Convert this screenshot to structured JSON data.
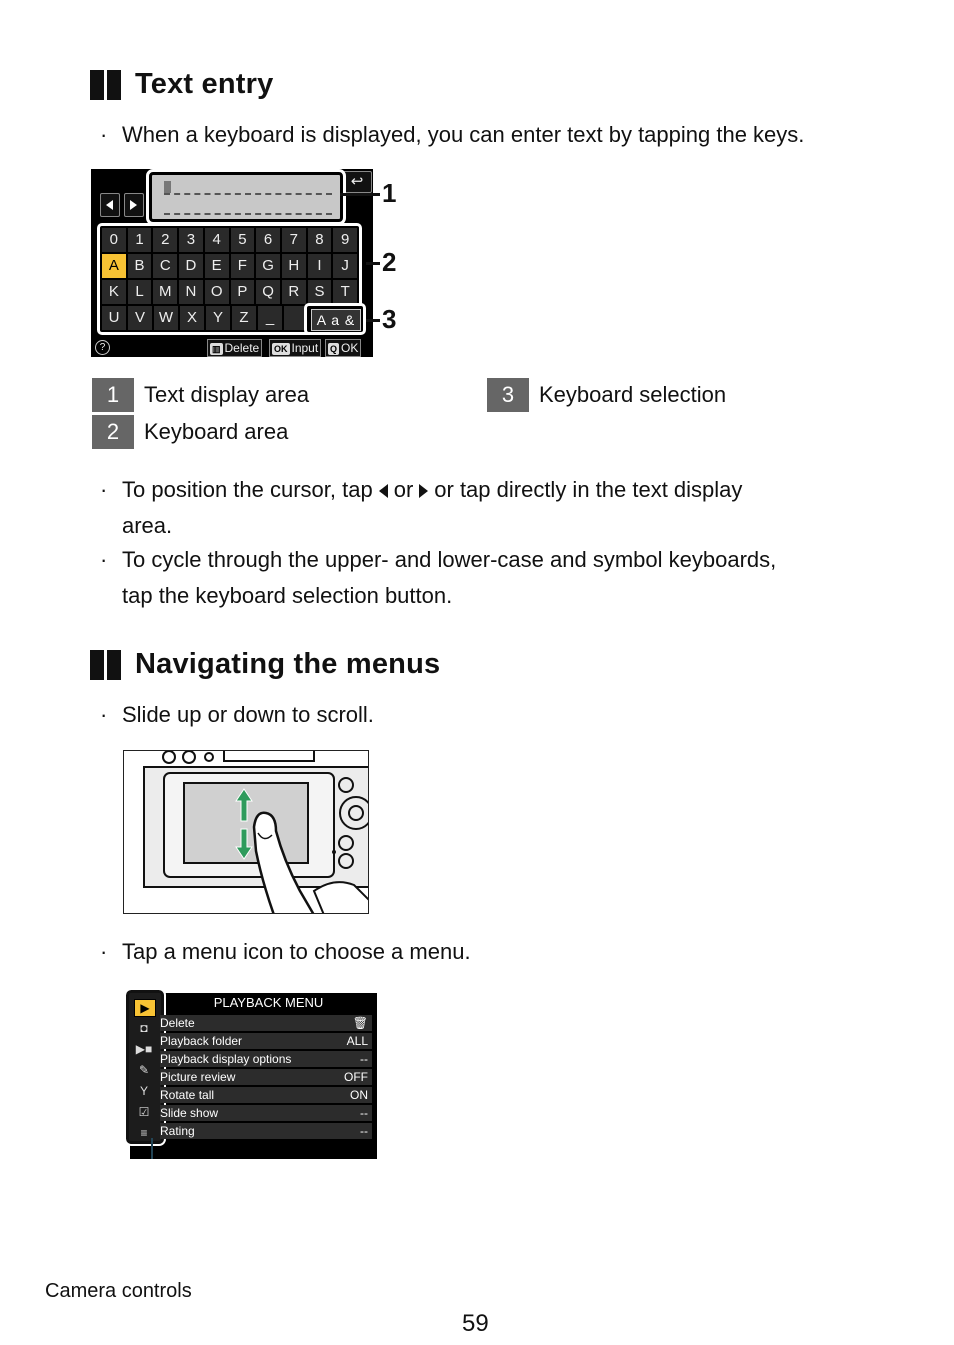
{
  "sections": [
    {
      "title": "Text entry",
      "bullets": [
        "When a keyboard is displayed, you can enter text by tapping the keys."
      ]
    },
    {
      "title": "Navigating the menus",
      "bullets": [
        "Slide up or down to scroll.",
        "Tap a menu icon to choose a menu."
      ]
    }
  ],
  "text_entry_bullets": {
    "cursor_part1": "To position the cursor, tap",
    "cursor_or": "or",
    "cursor_part2": "or tap directly in the text display",
    "cursor_part3": "area.",
    "cycle_line1": "To cycle through the upper- and lower-case and symbol keyboards,",
    "cycle_line2": "tap the keyboard selection button.",
    "bullet_char": "·"
  },
  "keyboard_screen": {
    "back_icon": "↩",
    "cursor_left_icon": "triangle-left",
    "cursor_right_icon": "triangle-right",
    "rows": [
      [
        "0",
        "1",
        "2",
        "3",
        "4",
        "5",
        "6",
        "7",
        "8",
        "9"
      ],
      [
        "A",
        "B",
        "C",
        "D",
        "E",
        "F",
        "G",
        "H",
        "I",
        "J"
      ],
      [
        "K",
        "L",
        "M",
        "N",
        "O",
        "P",
        "Q",
        "R",
        "S",
        "T"
      ],
      [
        "U",
        "V",
        "W",
        "X",
        "Y",
        "Z",
        "_",
        ""
      ]
    ],
    "selected_key": "A",
    "keyboard_selection_label": "A a &",
    "help_icon": "?",
    "buttons": [
      {
        "icon": "trash-icon",
        "glyph": "🗑",
        "label": "Delete"
      },
      {
        "icon": "ok-icon",
        "glyph": "OK",
        "label": "Input"
      },
      {
        "icon": "zoom-icon",
        "glyph": "Q",
        "label": "OK"
      }
    ],
    "callouts": [
      "1",
      "2",
      "3"
    ],
    "highlight_color": "#f7c234"
  },
  "legend": [
    {
      "num": "1",
      "label": "Text display area"
    },
    {
      "num": "2",
      "label": "Keyboard area"
    },
    {
      "num": "3",
      "label": "Keyboard selection"
    }
  ],
  "scroll_illustration": {
    "arrow_color": "#2e9b5c",
    "description": "finger sliding up or down on camera monitor"
  },
  "playback_menu": {
    "title": "PLAYBACK MENU",
    "side_icons": [
      "playback-icon",
      "camera-icon",
      "movie-icon",
      "pencil-icon",
      "wrench-icon",
      "retouch-icon",
      "my-menu-icon"
    ],
    "side_glyphs": [
      "▶",
      "◘",
      "▶■",
      "✎",
      "Y",
      "☑",
      "≡"
    ],
    "items": [
      {
        "label": "Delete",
        "value": "🗑"
      },
      {
        "label": "Playback folder",
        "value": "ALL"
      },
      {
        "label": "Playback display options",
        "value": "--"
      },
      {
        "label": "Picture review",
        "value": "OFF"
      },
      {
        "label": "Rotate tall",
        "value": "ON"
      },
      {
        "label": "Slide show",
        "value": "--"
      },
      {
        "label": "Rating",
        "value": "--"
      }
    ]
  },
  "footer": {
    "section": "Camera controls",
    "page": "59"
  }
}
